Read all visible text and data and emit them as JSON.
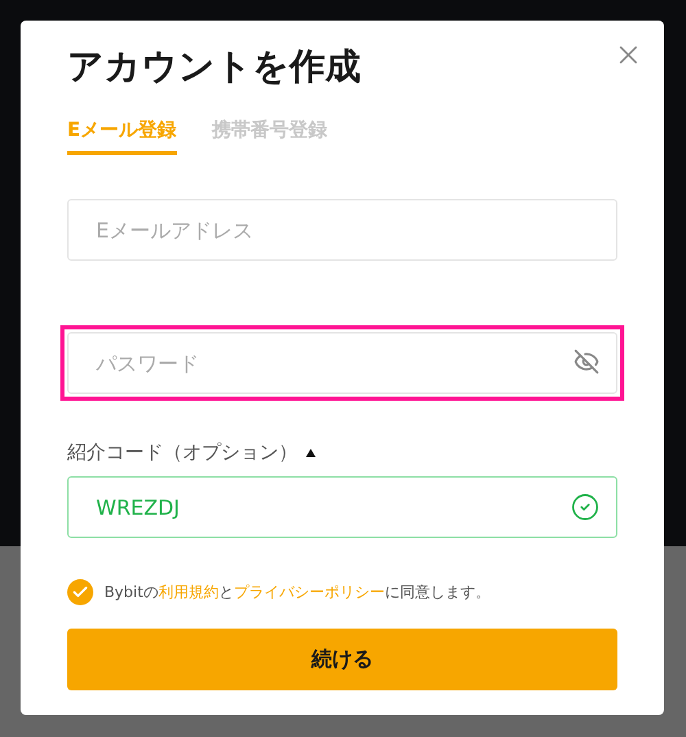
{
  "dialog": {
    "title": "アカウントを作成"
  },
  "tabs": [
    {
      "label": "Eメール登録",
      "selected": true
    },
    {
      "label": "携帯番号登録",
      "selected": false
    }
  ],
  "email": {
    "placeholder": "Eメールアドレス"
  },
  "password": {
    "placeholder": "パスワード",
    "highlighted": true,
    "hidden": true
  },
  "referral": {
    "label": "紹介コード（オプション）",
    "expanded": true,
    "value": "WREZDJ",
    "valid": true
  },
  "agreement": {
    "checked": true,
    "parts": [
      {
        "kind": "text",
        "text": "Bybitの"
      },
      {
        "kind": "link",
        "text": "利用規約"
      },
      {
        "kind": "text",
        "text": "と"
      },
      {
        "kind": "link",
        "text": "プライバシーポリシー"
      },
      {
        "kind": "text",
        "text": "に同意します。"
      }
    ]
  },
  "submit": {
    "label": "続ける"
  }
}
